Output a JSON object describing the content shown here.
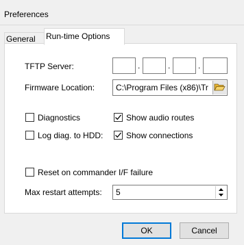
{
  "window": {
    "title": "Preferences"
  },
  "tabs": [
    {
      "label": "General",
      "active": false
    },
    {
      "label": "Run-time Options",
      "active": true
    }
  ],
  "tftp": {
    "label": "TFTP Server:",
    "octets": [
      "",
      "",
      "",
      ""
    ],
    "separator": "."
  },
  "firmware": {
    "label": "Firmware Location:",
    "value": "C:\\Program Files (x86)\\Tr",
    "browse_icon": "folder-open-icon"
  },
  "options": {
    "diagnostics": {
      "label": "Diagnostics",
      "checked": false
    },
    "log_diag": {
      "label": "Log diag. to HDD:",
      "checked": false
    },
    "show_audio_routes": {
      "label": "Show audio routes",
      "checked": true
    },
    "show_connections": {
      "label": "Show connections",
      "checked": true
    },
    "reset_on_failure": {
      "label": "Reset on commander I/F failure",
      "checked": false
    }
  },
  "max_restart": {
    "label": "Max restart attempts:",
    "value": "5"
  },
  "buttons": {
    "ok": "OK",
    "cancel": "Cancel"
  }
}
